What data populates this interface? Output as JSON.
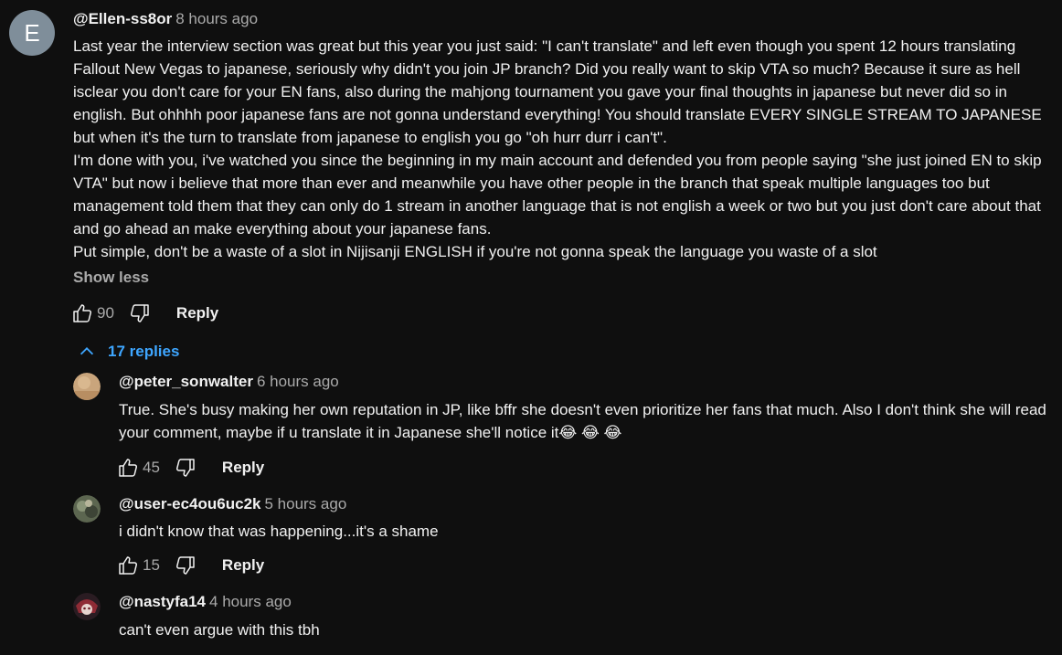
{
  "main_comment": {
    "avatar_letter": "E",
    "author": "@Ellen-ss8or",
    "time": "8 hours ago",
    "paragraphs": [
      "Last year the interview section was great but this year you just said: \"I can't translate\" and left even though you spent 12 hours translating Fallout New Vegas to japanese, seriously why didn't you join JP branch? Did you really want to skip VTA so much? Because it sure as hell isclear you don't care for your EN fans, also during the mahjong tournament you gave your final thoughts in japanese but never did so in english. But ohhhh poor japanese fans are not gonna understand everything! You should translate EVERY SINGLE STREAM TO JAPANESE but when it's the turn to translate from japanese to english you go \"oh hurr durr i can't\".",
      "I'm done with you, i've watched you since the beginning in my main account and defended you from people saying \"she just joined EN to skip VTA\" but now i believe that more than ever and meanwhile you have other people in the branch that speak multiple languages too but management told them that they can only do 1 stream in another language that is not english a week or two but you just don't care about that and go ahead an make everything about your japanese fans.",
      "Put simple, don't be a waste of a slot in Nijisanji ENGLISH if you're not gonna speak the language you waste of a slot"
    ],
    "show_less": "Show less",
    "likes": "90",
    "reply_label": "Reply"
  },
  "replies_toggle": {
    "label": "17 replies"
  },
  "replies": [
    {
      "author": "@peter_sonwalter",
      "time": "6 hours ago",
      "text": "True. She's busy making her own reputation in JP, like bffr she doesn't even prioritize her fans that much. Also I don't think she will read your comment, maybe if u translate it in Japanese she'll notice it😂 😂 😂",
      "likes": "45",
      "reply_label": "Reply"
    },
    {
      "author": "@user-ec4ou6uc2k",
      "time": "5 hours ago",
      "text": "i didn't know that was happening...it's a shame",
      "likes": "15",
      "reply_label": "Reply"
    },
    {
      "author": "@nastyfa14",
      "time": "4 hours ago",
      "text": "can't even argue with this tbh"
    }
  ],
  "colors": {
    "background": "#0f0f0f",
    "text": "#f1f1f1",
    "secondary": "#aaaaaa",
    "link": "#3ea6ff",
    "avatar_main": "#7f8e9a"
  }
}
